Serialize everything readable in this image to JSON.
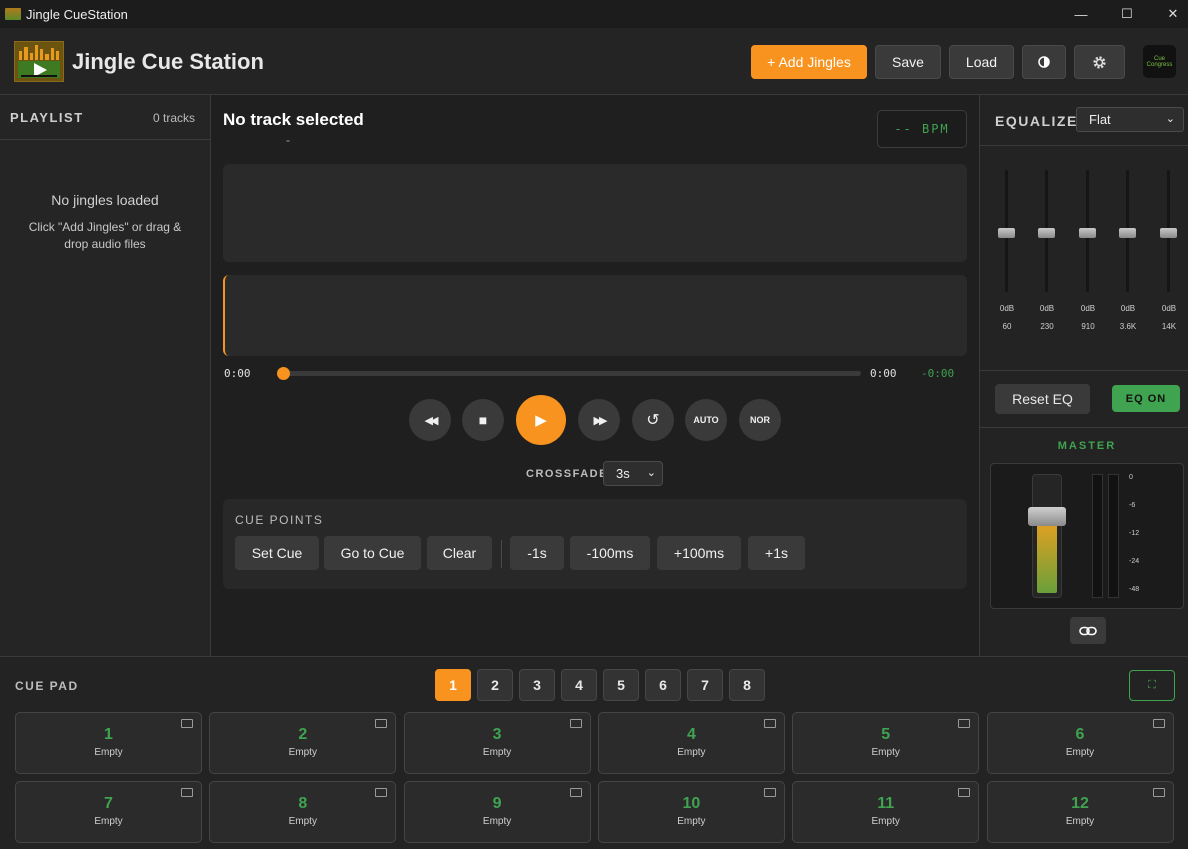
{
  "window": {
    "title": "Jingle CueStation",
    "controls": {
      "minimize": "—",
      "maximize": "☐",
      "close": "✕"
    }
  },
  "header": {
    "title": "Jingle Cue Station",
    "add_label": "+ Add Jingles",
    "save_label": "Save",
    "load_label": "Load",
    "theme_icon": "contrast-icon",
    "settings_icon": "gear-icon",
    "brand": "Cue Congress"
  },
  "playlist": {
    "title": "PLAYLIST",
    "count": "0 tracks",
    "empty": "No jingles loaded",
    "hint": "Click \"Add Jingles\" or drag & drop audio files"
  },
  "player": {
    "track_title": "No track selected",
    "track_sub": "-",
    "bpm": "-- BPM",
    "time_current": "0:00",
    "time_total": "0:00",
    "time_remaining": "-0:00",
    "progress": 0,
    "controls": [
      {
        "name": "rewind",
        "glyph": "◀◀"
      },
      {
        "name": "stop",
        "glyph": "■"
      },
      {
        "name": "play",
        "glyph": "▶"
      },
      {
        "name": "forward",
        "glyph": "▶▶"
      },
      {
        "name": "loop",
        "glyph": "↺"
      },
      {
        "name": "auto",
        "glyph": "AUTO"
      },
      {
        "name": "nor",
        "glyph": "NOR"
      }
    ],
    "crossfade_label": "CROSSFADE",
    "crossfade_value": "3s"
  },
  "cue_points": {
    "title": "CUE POINTS",
    "buttons": [
      "Set Cue",
      "Go to Cue",
      "Clear",
      "-1s",
      "-100ms",
      "+100ms",
      "+1s"
    ]
  },
  "equalizer": {
    "title": "EQUALIZER",
    "preset": "Flat",
    "bands": [
      {
        "gain": "0dB",
        "freq": "60"
      },
      {
        "gain": "0dB",
        "freq": "230"
      },
      {
        "gain": "0dB",
        "freq": "910"
      },
      {
        "gain": "0dB",
        "freq": "3.6K"
      },
      {
        "gain": "0dB",
        "freq": "14K"
      }
    ],
    "reset_label": "Reset EQ",
    "eq_on_label": "EQ ON"
  },
  "master": {
    "label": "MASTER",
    "level": 0.65,
    "scale": [
      "0",
      "-6",
      "-12",
      "-24",
      "-48"
    ]
  },
  "cue_pad": {
    "title": "CUE PAD",
    "pages": [
      "1",
      "2",
      "3",
      "4",
      "5",
      "6",
      "7",
      "8"
    ],
    "active_page": "1",
    "pads": [
      {
        "num": "1",
        "status": "Empty"
      },
      {
        "num": "2",
        "status": "Empty"
      },
      {
        "num": "3",
        "status": "Empty"
      },
      {
        "num": "4",
        "status": "Empty"
      },
      {
        "num": "5",
        "status": "Empty"
      },
      {
        "num": "6",
        "status": "Empty"
      },
      {
        "num": "7",
        "status": "Empty"
      },
      {
        "num": "8",
        "status": "Empty"
      },
      {
        "num": "9",
        "status": "Empty"
      },
      {
        "num": "10",
        "status": "Empty"
      },
      {
        "num": "11",
        "status": "Empty"
      },
      {
        "num": "12",
        "status": "Empty"
      }
    ]
  },
  "colors": {
    "accent": "#f7931e",
    "green": "#3fa350",
    "bg": "#1f1f1f"
  }
}
